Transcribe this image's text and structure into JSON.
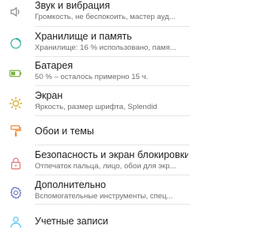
{
  "settings": {
    "items": [
      {
        "title": "Звук и вибрация",
        "subtitle": "Громкость, не беспокоить, мастер ауд...",
        "icon": "speaker-icon",
        "color": "#8a8a8a"
      },
      {
        "title": "Хранилище и память",
        "subtitle": "Хранилище: 16 % использовано, памя...",
        "icon": "storage-icon",
        "color": "#4db6ac"
      },
      {
        "title": "Батарея",
        "subtitle": "50 % – осталось примерно 15 ч.",
        "icon": "battery-icon",
        "color": "#7cb342"
      },
      {
        "title": "Экран",
        "subtitle": "Яркость, размер шрифта, Splendid",
        "icon": "brightness-icon",
        "color": "#d4a017"
      },
      {
        "title": "Обои и темы",
        "subtitle": "",
        "icon": "paint-roller-icon",
        "color": "#ef8a3c"
      },
      {
        "title": "Безопасность и экран блокировки",
        "subtitle": "Отпечаток пальца, лицо, обои для экр...",
        "icon": "lock-icon",
        "color": "#e57373"
      },
      {
        "title": "Дополнительно",
        "subtitle": "Вспомогательные инструменты, спец...",
        "icon": "gear-icon",
        "color": "#5c6bc0"
      },
      {
        "title": "Учетные записи",
        "subtitle": "",
        "icon": "account-icon",
        "color": "#4fc3f7"
      }
    ]
  }
}
